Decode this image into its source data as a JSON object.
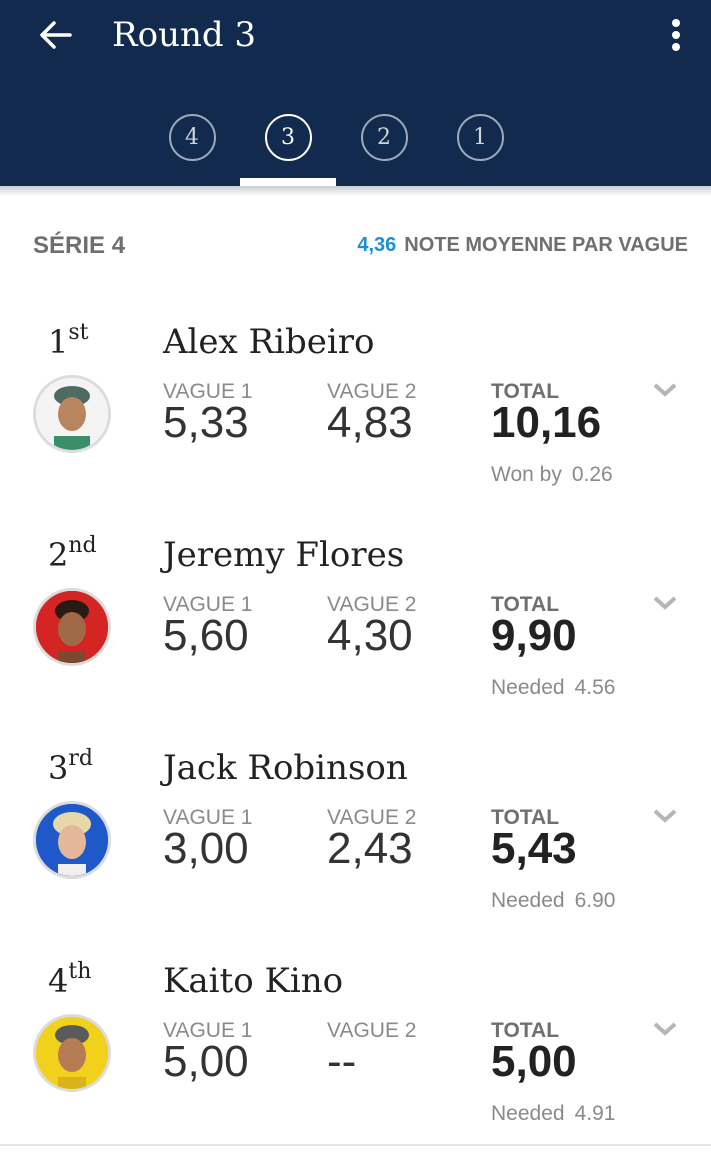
{
  "header": {
    "title": "Round 3",
    "back_icon": "arrow-left-icon",
    "menu_icon": "more-vert-icon"
  },
  "tabs": [
    {
      "label": "4",
      "active": false
    },
    {
      "label": "3",
      "active": true
    },
    {
      "label": "2",
      "active": false
    },
    {
      "label": "1",
      "active": false
    }
  ],
  "summary": {
    "serie": "SÉRIE 4",
    "average_value": "4,36",
    "average_label": "NOTE MOYENNE PAR VAGUE"
  },
  "columns": {
    "wave1": "VAGUE 1",
    "wave2": "VAGUE 2",
    "total": "TOTAL"
  },
  "surfers": [
    {
      "place_num": "1",
      "place_suffix": "st",
      "name": "Alex Ribeiro",
      "wave1": "5,33",
      "wave2": "4,83",
      "total": "10,16",
      "foot_label": "Won by",
      "foot_value": "0.26"
    },
    {
      "place_num": "2",
      "place_suffix": "nd",
      "name": "Jeremy Flores",
      "wave1": "5,60",
      "wave2": "4,30",
      "total": "9,90",
      "foot_label": "Needed",
      "foot_value": "4.56"
    },
    {
      "place_num": "3",
      "place_suffix": "rd",
      "name": "Jack Robinson",
      "wave1": "3,00",
      "wave2": "2,43",
      "total": "5,43",
      "foot_label": "Needed",
      "foot_value": "6.90"
    },
    {
      "place_num": "4",
      "place_suffix": "th",
      "name": "Kaito Kino",
      "wave1": "5,00",
      "wave2": "--",
      "total": "5,00",
      "foot_label": "Needed",
      "foot_value": "4.91"
    }
  ],
  "colors": {
    "header_bg": "#112a4d",
    "accent": "#1e8ed6",
    "avatar_bgs": [
      "#ffffff",
      "#d42424",
      "#1f59c9",
      "#f2d11c"
    ]
  }
}
